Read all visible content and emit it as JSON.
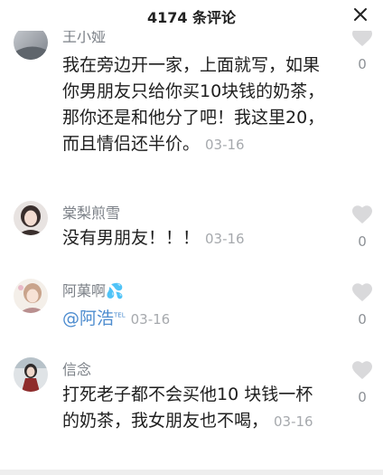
{
  "header": {
    "count": "4174",
    "suffix": " 条评论"
  },
  "comments": [
    {
      "username": "王小娅",
      "text": "我在旁边开一家，上面就写，如果你男朋友只给你买10块钱的奶茶，那你还是和他分了吧！我这里20，而且情侣还半价。",
      "date": "03-16",
      "likes": "0"
    },
    {
      "username": "棠梨煎雪",
      "text": "没有男朋友！！！",
      "date": "03-16",
      "likes": "0"
    },
    {
      "username": "阿菓啊💦",
      "mention": "@阿浩",
      "mention_badge": "TEL",
      "date": "03-16",
      "likes": "0"
    },
    {
      "username": "信念",
      "text": "打死老子都不会买他10 块钱一杯的奶茶，我女朋友也不喝，",
      "date": "03-16",
      "likes": "0"
    }
  ],
  "icons": {
    "close": "close-icon",
    "like": "heart-icon"
  },
  "colors": {
    "like_heart": "#d9d9db",
    "mention": "#4d8ccf",
    "username": "#7b8087",
    "date": "#a6a9ad"
  }
}
